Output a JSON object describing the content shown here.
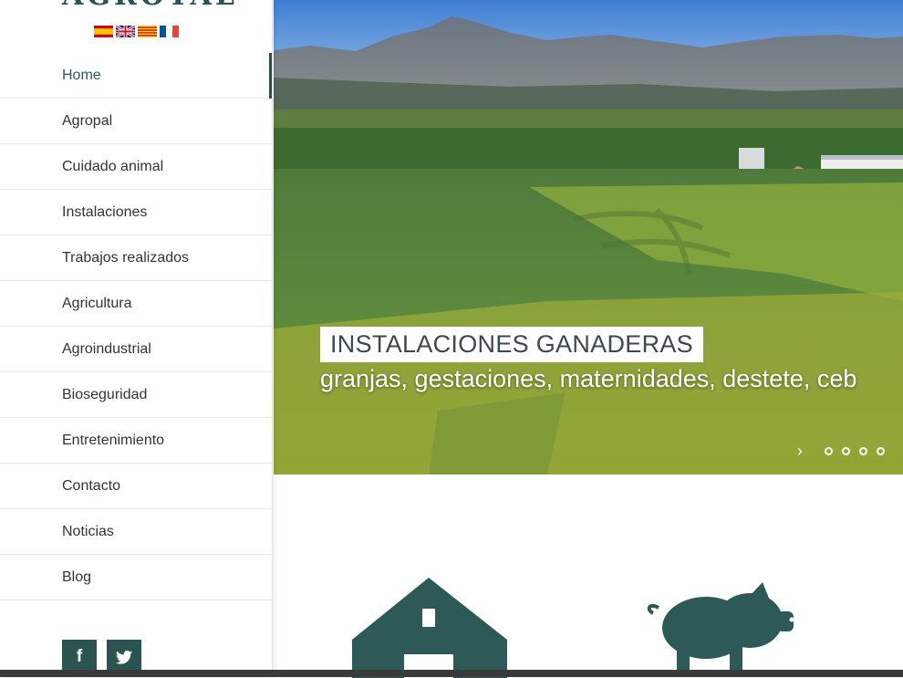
{
  "brand": {
    "logo_text": "AGROTAL"
  },
  "languages": [
    "es",
    "en",
    "ca",
    "fr"
  ],
  "nav": {
    "items": [
      {
        "label": "Home"
      },
      {
        "label": "Agropal"
      },
      {
        "label": "Cuidado animal"
      },
      {
        "label": "Instalaciones"
      },
      {
        "label": "Trabajos realizados"
      },
      {
        "label": "Agricultura"
      },
      {
        "label": "Agroindustrial"
      },
      {
        "label": "Bioseguridad"
      },
      {
        "label": "Entretenimiento"
      },
      {
        "label": "Contacto"
      },
      {
        "label": "Noticias"
      },
      {
        "label": "Blog"
      }
    ],
    "active_index": 0
  },
  "social": {
    "facebook_label": "f",
    "twitter_label": "t"
  },
  "hero": {
    "title": "INSTALACIONES GANADERAS",
    "subtitle": "granjas, gestaciones, maternidades, destete, ceb",
    "next_glyph": "›",
    "dot_count": 4
  },
  "features": {
    "icons": [
      "barn-icon",
      "pig-icon"
    ]
  },
  "colors": {
    "accent": "#2b5450",
    "text": "#333333",
    "divider": "#e6e6e6"
  }
}
